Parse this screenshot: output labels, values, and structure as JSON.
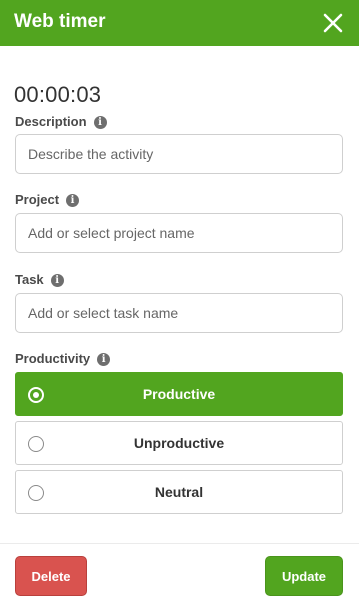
{
  "header": {
    "title": "Web timer",
    "close_icon": "close-icon"
  },
  "timer": {
    "elapsed": "00:00:03"
  },
  "description": {
    "label": "Description",
    "placeholder": "Describe the activity",
    "value": ""
  },
  "project": {
    "label": "Project",
    "placeholder": "Add or select project name",
    "value": ""
  },
  "task": {
    "label": "Task",
    "placeholder": "Add or select task name",
    "value": ""
  },
  "productivity": {
    "label": "Productivity",
    "options": [
      {
        "label": "Productive",
        "selected": true
      },
      {
        "label": "Unproductive",
        "selected": false
      },
      {
        "label": "Neutral",
        "selected": false
      }
    ]
  },
  "footer": {
    "delete_label": "Delete",
    "update_label": "Update"
  },
  "colors": {
    "accent": "#52a51f",
    "danger": "#d9534f"
  }
}
